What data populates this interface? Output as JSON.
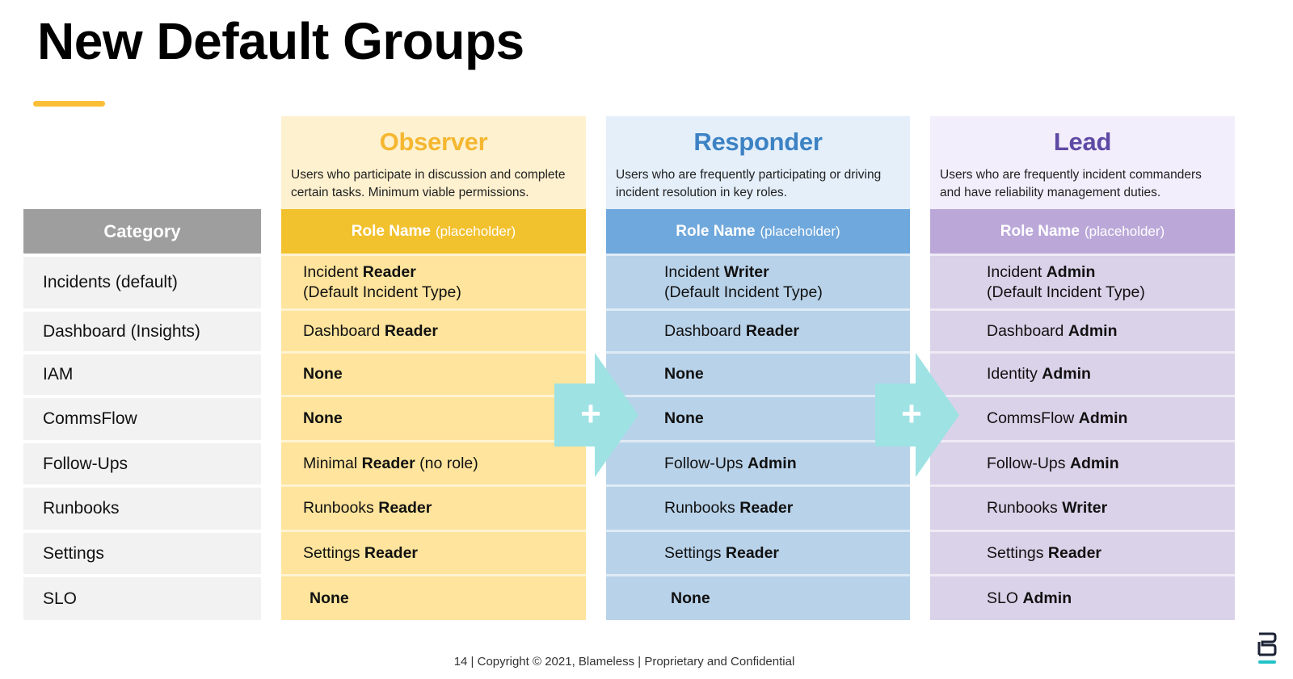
{
  "title": "New Default Groups",
  "colors": {
    "accent": "#FBBF37",
    "observer_title": "#F5B731",
    "observer_head_bg": "#FEF1CF",
    "observer_role_bg": "#F2C12E",
    "observer_cell_bg": "#FEE49C",
    "responder_title": "#3C82C4",
    "responder_head_bg": "#E4EFFA",
    "responder_role_bg": "#6FA8DC",
    "responder_cell_bg": "#B8D2E9",
    "lead_title": "#5E4AA5",
    "lead_head_bg": "#F2EEFC",
    "lead_role_bg": "#BBA8D9",
    "lead_cell_bg": "#DAD2E9",
    "category_head_bg": "#9E9E9E",
    "category_cell_bg": "#F2F2F2",
    "arrow": "#9EE2E4",
    "logo_dark": "#1B2235",
    "logo_accent": "#22C3C8"
  },
  "category": {
    "header": "Category",
    "items": [
      "Incidents (default)",
      "Dashboard (Insights)",
      "IAM",
      "CommsFlow",
      "Follow-Ups",
      "Runbooks",
      "Settings",
      "SLO"
    ]
  },
  "groups": [
    {
      "name": "Observer",
      "description_line1": "Users who participate in discussion and complete",
      "description_line2": "certain tasks. Minimum viable permissions.",
      "role_label": "Role Name",
      "role_placeholder": "(placeholder)",
      "cells": [
        {
          "pre": "Incident ",
          "bold": "Reader",
          "post": "",
          "line2": "(Default Incident Type)"
        },
        {
          "pre": "Dashboard ",
          "bold": "Reader",
          "post": ""
        },
        {
          "pre": "",
          "bold": "None",
          "post": ""
        },
        {
          "pre": "",
          "bold": "None",
          "post": ""
        },
        {
          "pre": "Minimal ",
          "bold": "Reader",
          "post": " (no role)"
        },
        {
          "pre": "Runbooks ",
          "bold": "Reader",
          "post": ""
        },
        {
          "pre": "Settings ",
          "bold": "Reader",
          "post": ""
        },
        {
          "pre": "",
          "bold": "None",
          "post": ""
        }
      ]
    },
    {
      "name": "Responder",
      "description_line1": "Users who are frequently participating or driving",
      "description_line2": "incident resolution in key roles.",
      "role_label": "Role Name",
      "role_placeholder": "(placeholder)",
      "cells": [
        {
          "pre": "Incident ",
          "bold": "Writer",
          "post": "",
          "line2": "(Default Incident Type)"
        },
        {
          "pre": "Dashboard ",
          "bold": "Reader",
          "post": ""
        },
        {
          "pre": "",
          "bold": "None",
          "post": ""
        },
        {
          "pre": "",
          "bold": "None",
          "post": ""
        },
        {
          "pre": "Follow-Ups ",
          "bold": "Admin",
          "post": ""
        },
        {
          "pre": "Runbooks ",
          "bold": "Reader",
          "post": ""
        },
        {
          "pre": "Settings ",
          "bold": "Reader",
          "post": ""
        },
        {
          "pre": "",
          "bold": "None",
          "post": ""
        }
      ]
    },
    {
      "name": "Lead",
      "description_line1": "Users who are frequently incident commanders",
      "description_line2": "and have reliability management duties.",
      "role_label": "Role Name",
      "role_placeholder": "(placeholder)",
      "cells": [
        {
          "pre": "Incident ",
          "bold": "Admin",
          "post": "",
          "line2": "(Default Incident Type)"
        },
        {
          "pre": "Dashboard ",
          "bold": "Admin",
          "post": ""
        },
        {
          "pre": "Identity ",
          "bold": "Admin",
          "post": ""
        },
        {
          "pre": "CommsFlow ",
          "bold": "Admin",
          "post": ""
        },
        {
          "pre": "Follow-Ups ",
          "bold": "Admin",
          "post": ""
        },
        {
          "pre": "Runbooks ",
          "bold": "Writer",
          "post": ""
        },
        {
          "pre": "Settings ",
          "bold": "Reader",
          "post": ""
        },
        {
          "pre": "SLO ",
          "bold": "Admin",
          "post": ""
        }
      ]
    }
  ],
  "arrows": [
    {
      "icon": "plus-arrow-icon",
      "symbol": "+"
    },
    {
      "icon": "plus-arrow-icon",
      "symbol": "+"
    }
  ],
  "footer": "14 | Copyright © 2021, Blameless | Proprietary and Confidential",
  "logo": {
    "icon": "blameless-logo-icon"
  }
}
